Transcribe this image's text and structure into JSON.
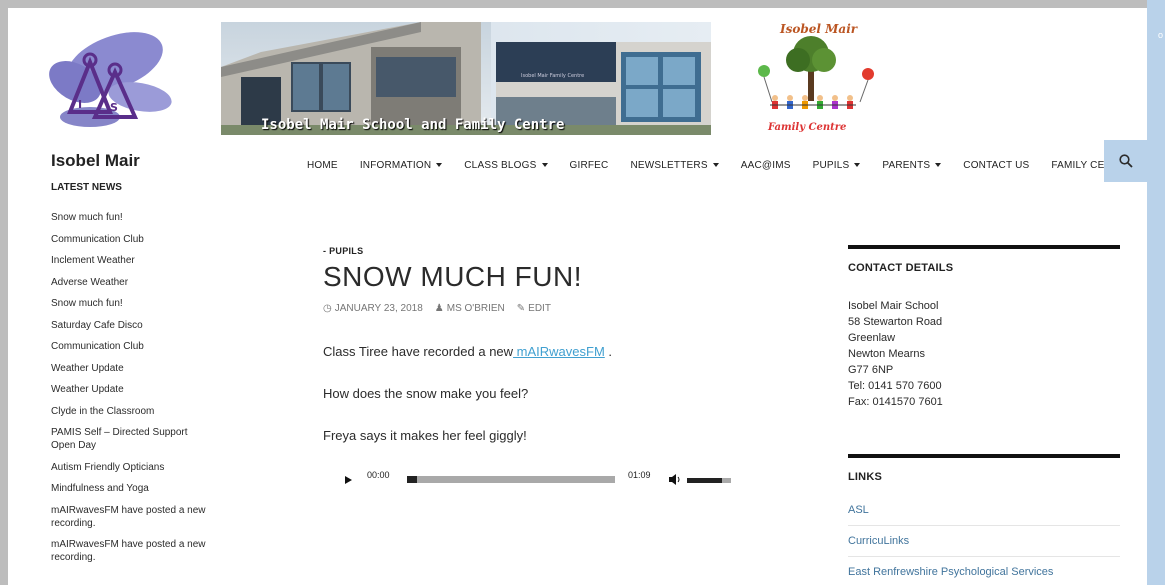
{
  "header": {
    "photo_caption": "Isobel Mair School and Family Centre",
    "building_sign": "Isobel Mair Family Centre",
    "right_logo_top": "Isobel Mair",
    "right_logo_bottom": "Family Centre",
    "site_title": "Isobel Mair"
  },
  "nav": {
    "items": [
      {
        "label": "HOME",
        "dropdown": false
      },
      {
        "label": "INFORMATION",
        "dropdown": true
      },
      {
        "label": "CLASS BLOGS",
        "dropdown": true
      },
      {
        "label": "GIRFEC",
        "dropdown": false
      },
      {
        "label": "NEWSLETTERS",
        "dropdown": true
      },
      {
        "label": "AAC@IMS",
        "dropdown": false
      },
      {
        "label": "PUPILS",
        "dropdown": true
      },
      {
        "label": "PARENTS",
        "dropdown": true
      },
      {
        "label": "CONTACT US",
        "dropdown": false
      },
      {
        "label": "FAMILY CENTRE",
        "dropdown": false
      }
    ],
    "search_icon": "search-icon"
  },
  "sidebar": {
    "heading": "LATEST NEWS",
    "items": [
      "Snow much fun!",
      "Communication Club",
      "Inclement Weather",
      "Adverse Weather",
      "Snow much fun!",
      "Saturday Cafe Disco",
      "Communication Club",
      "Weather Update",
      "Weather Update",
      "Clyde in the Classroom",
      "PAMIS Self – Directed Support Open Day",
      "Autism Friendly Opticians",
      "Mindfulness and Yoga",
      "mAIRwavesFM have posted a new recording.",
      "mAIRwavesFM have posted a new recording."
    ]
  },
  "post": {
    "category": "- PUPILS",
    "title": "SNOW MUCH FUN!",
    "date": "JANUARY 23, 2018",
    "author": "MS O'BRIEN",
    "edit": "EDIT",
    "para1_before": "Class Tiree have recorded a new",
    "para1_link": " mAIRwavesFM",
    "para1_after": " .",
    "para2": "How does the snow make you feel?",
    "para3": "Freya says it makes her feel giggly!",
    "audio": {
      "current_time": "00:00",
      "duration": "01:09",
      "progress": 0.0,
      "volume": 0.8
    }
  },
  "contact": {
    "title": "CONTACT DETAILS",
    "lines": [
      "Isobel Mair School",
      "58 Stewarton Road",
      "Greenlaw",
      "Newton Mearns",
      "G77 6NP",
      "Tel: 0141 570 7600",
      "Fax: 0141570 7601"
    ]
  },
  "links": {
    "title": "LINKS",
    "items": [
      "ASL",
      "CurricuLinks",
      "East Renfrewshire Psychological Services"
    ]
  },
  "colors": {
    "accent": "#b9d2ea",
    "link": "#41749c",
    "text": "#2b2b2b"
  }
}
